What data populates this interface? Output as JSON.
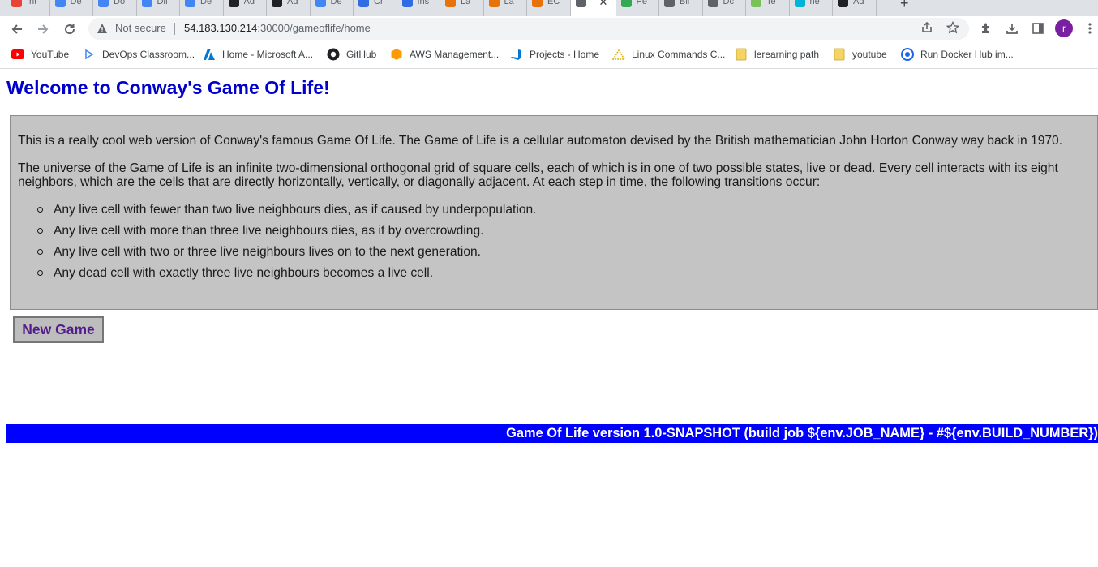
{
  "browser": {
    "tabs": [
      {
        "label": "Int",
        "icon": "gmail-icon",
        "color": "#ea4335",
        "active": false
      },
      {
        "label": "De",
        "icon": "play-icon",
        "color": "#4285f4",
        "active": false
      },
      {
        "label": "Do",
        "icon": "play-icon",
        "color": "#4285f4",
        "active": false
      },
      {
        "label": "Dif",
        "icon": "play-icon",
        "color": "#4285f4",
        "active": false
      },
      {
        "label": "De",
        "icon": "play-icon",
        "color": "#4285f4",
        "active": false
      },
      {
        "label": "Ad",
        "icon": "github-icon",
        "color": "#202124",
        "active": false
      },
      {
        "label": "Ad",
        "icon": "github-icon",
        "color": "#202124",
        "active": false
      },
      {
        "label": "De",
        "icon": "play-icon",
        "color": "#4285f4",
        "active": false
      },
      {
        "label": "Cr",
        "icon": "kubernetes-icon",
        "color": "#326ce5",
        "active": false
      },
      {
        "label": "Ins",
        "icon": "kubernetes-icon",
        "color": "#326ce5",
        "active": false
      },
      {
        "label": "La",
        "icon": "aws-icon",
        "color": "#e8710a",
        "active": false
      },
      {
        "label": "La",
        "icon": "aws-icon",
        "color": "#e8710a",
        "active": false
      },
      {
        "label": "EC",
        "icon": "aws-icon",
        "color": "#e8710a",
        "active": false
      },
      {
        "label": "",
        "icon": "globe-icon",
        "color": "#5f6368",
        "active": true
      },
      {
        "label": "Pe",
        "icon": "refresh-icon",
        "color": "#34a853",
        "active": false
      },
      {
        "label": "Bil",
        "icon": "bitcoin-icon",
        "color": "#5f6368",
        "active": false
      },
      {
        "label": "Dc",
        "icon": "globe-icon",
        "color": "#5f6368",
        "active": false
      },
      {
        "label": "Te",
        "icon": "android-icon",
        "color": "#78c257",
        "active": false
      },
      {
        "label": "ne",
        "icon": "grid-icon",
        "color": "#00b4d8",
        "active": false
      },
      {
        "label": "Ad",
        "icon": "github-icon",
        "color": "#202124",
        "active": false
      }
    ],
    "not_secure_label": "Not secure",
    "url_host": "54.183.130.214",
    "url_rest": ":30000/gameoflife/home",
    "avatar_letter": "r",
    "bookmarks": [
      {
        "label": "YouTube",
        "icon": "youtube-icon",
        "color": "#ff0000"
      },
      {
        "label": "DevOps Classroom...",
        "icon": "play-icon",
        "color": "#4285f4"
      },
      {
        "label": "Home - Microsoft A...",
        "icon": "azure-icon",
        "color": "#0078d4"
      },
      {
        "label": "GitHub",
        "icon": "github-icon",
        "color": "#202124"
      },
      {
        "label": "AWS Management...",
        "icon": "aws-icon",
        "color": "#ff9900"
      },
      {
        "label": "Projects - Home",
        "icon": "azure-devops-icon",
        "color": "#0078d7"
      },
      {
        "label": "Linux Commands C...",
        "icon": "linux-icon",
        "color": "#e0b000"
      },
      {
        "label": "lerearning path",
        "icon": "folder-icon",
        "color": "#f6d365"
      },
      {
        "label": "youtube",
        "icon": "folder-icon",
        "color": "#f6d365"
      },
      {
        "label": "Run Docker Hub im...",
        "icon": "docker-icon",
        "color": "#1d63ed"
      }
    ]
  },
  "page": {
    "title": "Welcome to Conway's Game Of Life!",
    "intro": "This is a really cool web version of Conway's famous Game Of Life. The Game of Life is a cellular automaton devised by the British mathematician John Horton Conway way back in 1970.",
    "description": "The universe of the Game of Life is an infinite two-dimensional orthogonal grid of square cells, each of which is in one of two possible states, live or dead. Every cell interacts with its eight neighbors, which are the cells that are directly horizontally, vertically, or diagonally adjacent. At each step in time, the following transitions occur:",
    "rules": [
      "Any live cell with fewer than two live neighbours dies, as if caused by underpopulation.",
      "Any live cell with more than three live neighbours dies, as if by overcrowding.",
      "Any live cell with two or three live neighbours lives on to the next generation.",
      "Any dead cell with exactly three live neighbours becomes a live cell."
    ],
    "new_game_label": "New Game",
    "footer": "Game Of Life version 1.0-SNAPSHOT (build job ${env.JOB_NAME} - #${env.BUILD_NUMBER})",
    "colors": {
      "title": "#0000cc",
      "panel": "#c4c4c4",
      "footer_bg": "#0000ff",
      "button_text": "#551a8b"
    }
  }
}
